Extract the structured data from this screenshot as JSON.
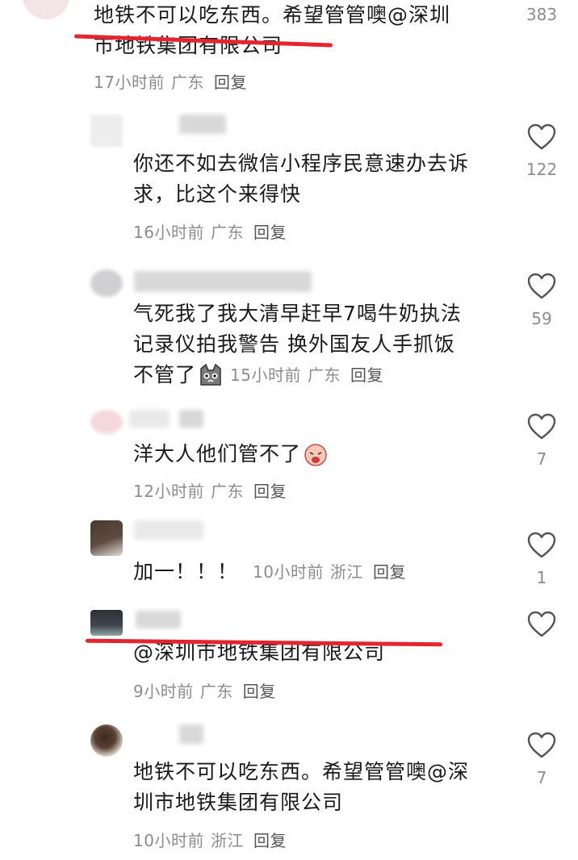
{
  "comments": [
    {
      "text_lines": [
        "地铁不可以吃东西。希望管管噢@深圳",
        "市地铁集团有限公司"
      ],
      "time": "17小时前",
      "location": "广东",
      "reply": "回复",
      "likes": "383"
    },
    {
      "text_lines": [
        "你还不如去微信小程序民意速办去诉",
        "求，比这个来得快"
      ],
      "time": "16小时前",
      "location": "广东",
      "reply": "回复",
      "likes": "122"
    },
    {
      "text_lines": [
        "气死我了我大清早赶早7喝牛奶执法",
        "记录仪拍我警告 换外国友人手抓饭",
        "不管了"
      ],
      "time": "15小时前",
      "location": "广东",
      "reply": "回复",
      "likes": "59"
    },
    {
      "text_lines": [
        "洋大人他们管不了"
      ],
      "time": "12小时前",
      "location": "广东",
      "reply": "回复",
      "likes": "7"
    },
    {
      "text_lines": [
        "加一！！！"
      ],
      "time": "10小时前",
      "location": "浙江",
      "reply": "回复",
      "likes": "1"
    },
    {
      "text_lines": [
        "@深圳市地铁集团有限公司"
      ],
      "time": "9小时前",
      "location": "广东",
      "reply": "回复",
      "likes": ""
    },
    {
      "text_lines": [
        "地铁不可以吃东西。希望管管噢@深",
        "圳市地铁集团有限公司"
      ],
      "time": "10小时前",
      "location": "浙江",
      "reply": "回复",
      "likes": "7"
    }
  ],
  "colors": {
    "underline": "#e4242e",
    "meta": "#8c8c8c",
    "text": "#1a1a1a"
  },
  "icons": {
    "like": "heart-outline-icon",
    "emoji_cat": "cat-emoji",
    "emoji_cry": "crying-face-emoji"
  }
}
